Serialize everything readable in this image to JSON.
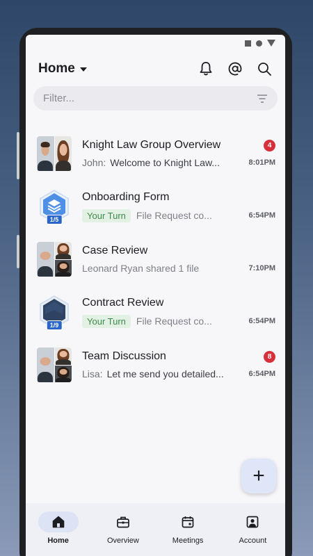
{
  "header": {
    "title": "Home",
    "icons": [
      "bell-icon",
      "mention-icon",
      "search-icon"
    ]
  },
  "filter": {
    "placeholder": "Filter..."
  },
  "conversations": [
    {
      "title": "Knight Law Group Overview",
      "sender": "John:",
      "preview": "Welcome to Knight Law...",
      "time": "8:01PM",
      "unread": "4"
    },
    {
      "title": "Onboarding Form",
      "chip": "Your Turn",
      "preview": "File Request co...",
      "time": "6:54PM",
      "progress": "1/5"
    },
    {
      "title": "Case Review",
      "preview": "Leonard Ryan shared 1 file",
      "time": "7:10PM"
    },
    {
      "title": "Contract Review",
      "chip": "Your Turn",
      "preview": "File Request co...",
      "time": "6:54PM",
      "progress": "1/9"
    },
    {
      "title": "Team Discussion",
      "sender": "Lisa:",
      "preview": "Let me send you detailed...",
      "time": "6:54PM",
      "unread": "8"
    }
  ],
  "fab": {
    "label": "+"
  },
  "nav": {
    "items": [
      {
        "label": "Home",
        "icon": "home-icon",
        "active": true
      },
      {
        "label": "Overview",
        "icon": "briefcase-icon",
        "active": false
      },
      {
        "label": "Meetings",
        "icon": "calendar-icon",
        "active": false
      },
      {
        "label": "Account",
        "icon": "account-icon",
        "active": false
      }
    ]
  },
  "colors": {
    "accent": "#2a66c9",
    "badge": "#d7303a",
    "chip_bg": "#e3f1e5",
    "chip_text": "#3c8a4b",
    "nav_active": "#dbe3f4"
  }
}
